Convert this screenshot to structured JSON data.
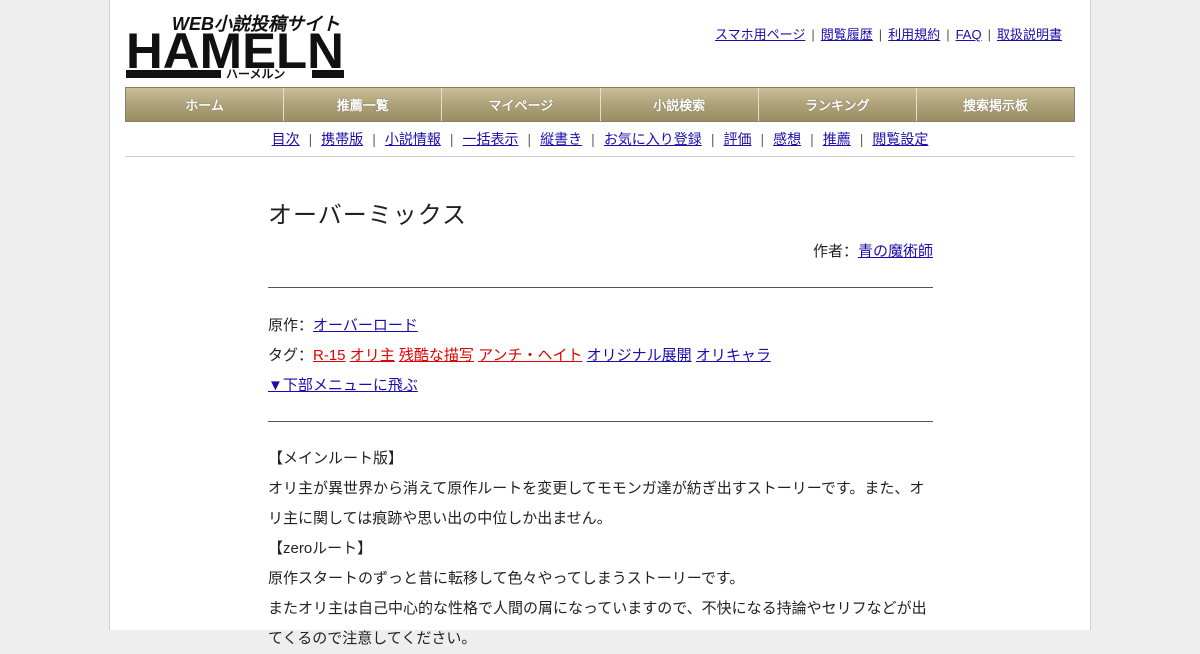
{
  "header": {
    "logo_tagline": "WEB小説投稿サイト",
    "logo_text": "HAMELN",
    "logo_kana": "ハーメルン",
    "top_links": [
      "スマホ用ページ",
      "閲覧履歴",
      "利用規約",
      "FAQ",
      "取扱説明書"
    ]
  },
  "nav": [
    "ホーム",
    "推薦一覧",
    "マイページ",
    "小説検索",
    "ランキング",
    "捜索掲示板"
  ],
  "subnav": [
    "目次",
    "携帯版",
    "小説情報",
    "一括表示",
    "縦書き",
    "お気に入り登録",
    "評価",
    "感想",
    "推薦",
    "閲覧設定"
  ],
  "novel": {
    "title": "オーバーミックス",
    "author_label": "作者：",
    "author": "青の魔術師",
    "original_label": "原作：",
    "original": "オーバーロード",
    "tags_label": "タグ：",
    "tags_red": [
      "R-15",
      "オリ主",
      "残酷な描写",
      "アンチ・ヘイト"
    ],
    "tags_blue": [
      "オリジナル展開",
      "オリキャラ"
    ],
    "jump_link": "▼下部メニューに飛ぶ"
  },
  "summary": [
    "【メインルート版】",
    "オリ主が異世界から消えて原作ルートを変更してモモンガ達が紡ぎ出すストーリーです。また、オリ主に関しては痕跡や思い出の中位しか出ません。",
    "【zeroルート】",
    "原作スタートのずっと昔に転移して色々やってしまうストーリーです。",
    "またオリ主は自己中心的な性格で人間の屑になっていますので、不快になる持論やセリフなどが出てくるので注意してください。"
  ]
}
